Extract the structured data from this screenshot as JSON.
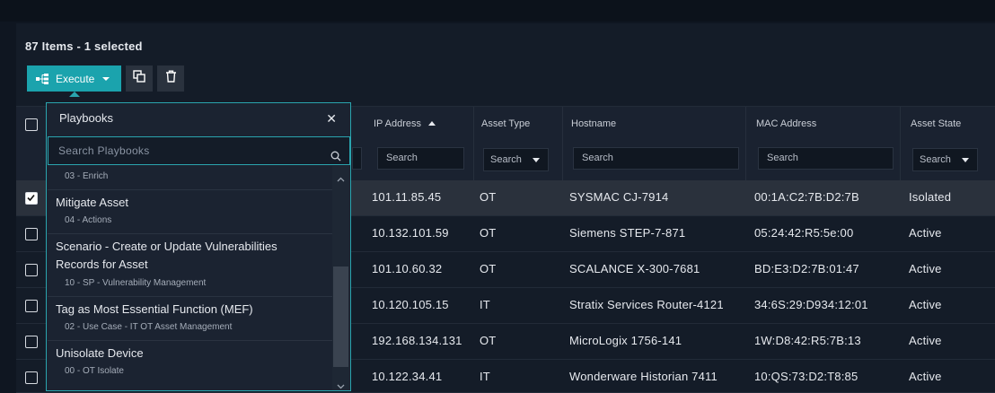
{
  "summary": "87 Items - 1 selected",
  "toolbar": {
    "execute_label": "Execute",
    "accent": "#1ba3ad"
  },
  "columns": {
    "ip": "IP Address",
    "type": "Asset Type",
    "host": "Hostname",
    "mac": "MAC Address",
    "state": "Asset State"
  },
  "search_placeholder": "Search",
  "rows": [
    {
      "ip": "101.11.85.45",
      "type": "OT",
      "host": "SYSMAC CJ-7914",
      "mac": "00:1A:C2:7B:D2:7B",
      "state": "Isolated",
      "selected": true
    },
    {
      "ip": "10.132.101.59",
      "type": "OT",
      "host": "Siemens STEP-7-871",
      "mac": "05:24:42:R5:5e:00",
      "state": "Active",
      "selected": false
    },
    {
      "ip": "101.10.60.32",
      "type": "OT",
      "host": "SCALANCE X-300-7681",
      "mac": "BD:E3:D2:7B:01:47",
      "state": "Active",
      "selected": false
    },
    {
      "ip": "10.120.105.15",
      "type": "IT",
      "host": "Stratix Services Router-4121",
      "mac": "34:6S:29:D934:12:01",
      "state": "Active",
      "selected": false
    },
    {
      "ip": "192.168.134.131",
      "type": "OT",
      "host": "MicroLogix 1756-141",
      "mac": "1W:D8:42:R5:7B:13",
      "state": "Active",
      "selected": false
    },
    {
      "ip": "10.122.34.41",
      "type": "IT",
      "host": "Wonderware Historian 7411",
      "mac": "10:QS:73:D2:T8:85",
      "state": "Active",
      "selected": false
    }
  ],
  "playbooks": {
    "title": "Playbooks",
    "search_placeholder": "Search Playbooks",
    "items": [
      {
        "name": "",
        "sub": "03 - Enrich"
      },
      {
        "name": "Mitigate Asset",
        "sub": "04 - Actions"
      },
      {
        "name": "Scenario - Create or Update Vulnerabilities Records for Asset",
        "sub": "10 - SP - Vulnerability Management"
      },
      {
        "name": "Tag as Most Essential Function (MEF)",
        "sub": "02 - Use Case - IT OT Asset Management"
      },
      {
        "name": "Unisolate Device",
        "sub": "00 - OT Isolate"
      }
    ]
  }
}
